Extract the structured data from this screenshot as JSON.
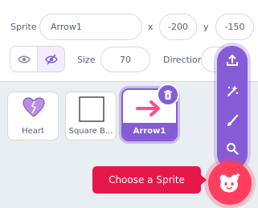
{
  "sprite_info": {
    "sprite_label": "Sprite",
    "sprite_name": "Arrow1",
    "x_label": "x",
    "x_value": "-200",
    "y_label": "y",
    "y_value": "-150",
    "size_label": "Size",
    "size_value": "70",
    "direction_label": "Direction"
  },
  "sprites": [
    {
      "name": "Heart"
    },
    {
      "name": "Square B..."
    },
    {
      "name": "Arrow1",
      "selected": true
    }
  ],
  "menu": {
    "items": [
      "upload-icon",
      "surprise-icon",
      "paint-icon",
      "search-icon"
    ]
  },
  "choose_tooltip": "Choose a Sprite",
  "colors": {
    "accent": "#855cd6",
    "choose": "#ff3d5e",
    "tooltip": "#e6174a",
    "arrow": "#ff4c8b",
    "heart": "#b98ee6"
  }
}
